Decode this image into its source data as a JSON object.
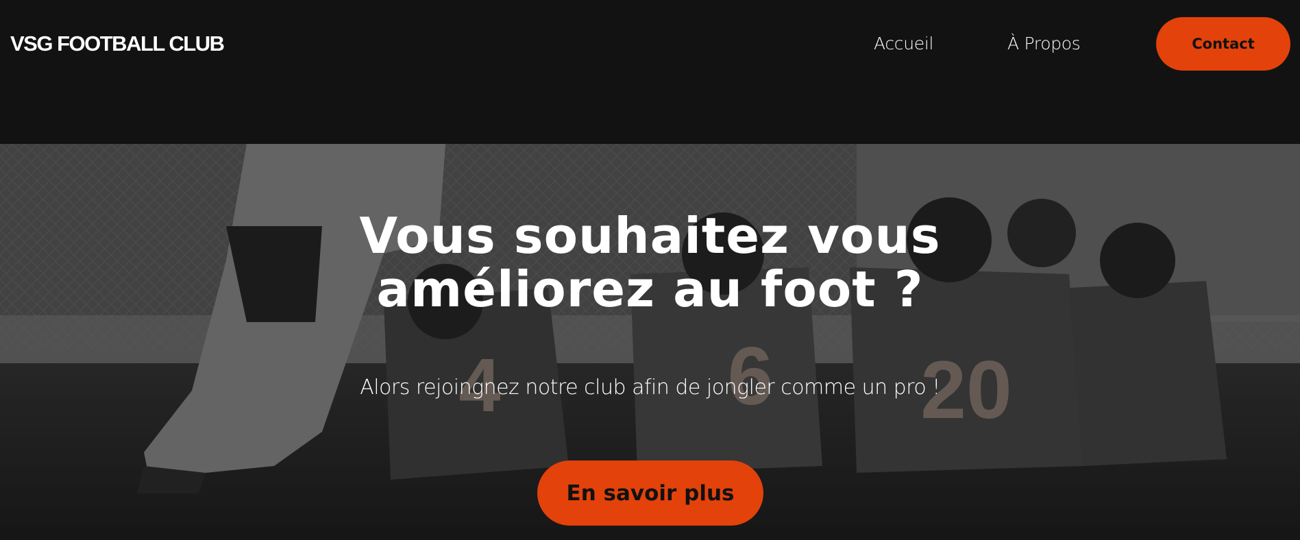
{
  "header": {
    "logo": "VSG FOOTBALL CLUB",
    "nav": {
      "home": "Accueil",
      "about": "À Propos",
      "contact": "Contact"
    }
  },
  "hero": {
    "title_line1": "Vous souhaitez vous",
    "title_line2": "améliorez au foot ?",
    "subtitle": "Alors rejoingnez notre club afin de jongler comme un pro !",
    "cta": "En savoir plus",
    "background_image": "youth football team sitting on grass with coach",
    "jersey_numbers": [
      "4",
      "6",
      "20"
    ]
  },
  "colors": {
    "header_bg": "#121212",
    "accent": "#e3420b",
    "text": "#ffffff"
  }
}
